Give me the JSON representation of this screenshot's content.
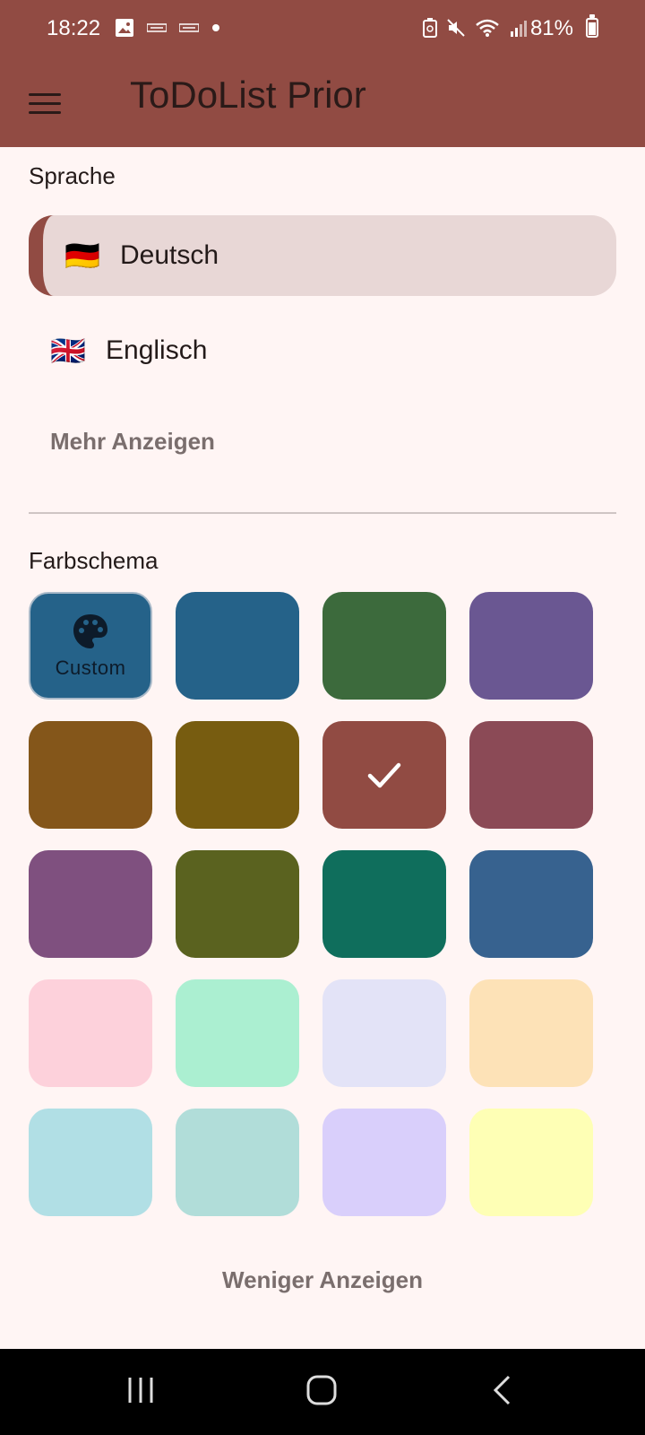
{
  "status_bar": {
    "time": "18:22",
    "battery": "81%"
  },
  "app_bar": {
    "title": "ToDoList Prior",
    "menu_icon": "hamburger-menu-icon"
  },
  "language": {
    "heading": "Sprache",
    "options": [
      {
        "flag": "🇩🇪",
        "label": "Deutsch",
        "selected": true
      },
      {
        "flag": "🇬🇧",
        "label": "Englisch",
        "selected": false
      }
    ],
    "more_label": "Mehr Anzeigen"
  },
  "color_scheme": {
    "heading": "Farbschema",
    "custom_label": "Custom",
    "selected_index": 6,
    "swatches": [
      "#256289",
      "#256289",
      "#3c6a3c",
      "#6a5792",
      "#84561a",
      "#775c10",
      "#914b43",
      "#8b4a56",
      "#7f507f",
      "#5a621f",
      "#0f6e5c",
      "#37628f",
      "#fdd1db",
      "#abefd1",
      "#e3e3f7",
      "#fde2b7",
      "#b1dfe5",
      "#b1ddd9",
      "#d9cffb",
      "#feffb5"
    ],
    "less_label": "Weniger Anzeigen"
  },
  "accent_color": "#914b43"
}
